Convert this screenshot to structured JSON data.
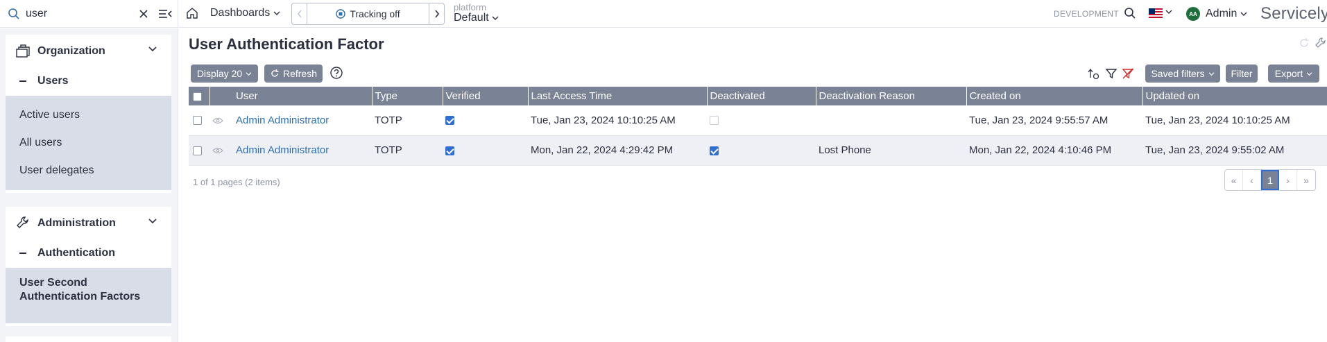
{
  "search": {
    "value": "user"
  },
  "topbar": {
    "dashboards_label": "Dashboards",
    "tracking_label": "Tracking off",
    "platform_label": "platform",
    "platform_value": "Default",
    "environment": "DEVELOPMENT",
    "user_initials": "AA",
    "user_name": "Admin",
    "brand": "Servicely"
  },
  "sidebar": {
    "sections": [
      {
        "title": "Organization",
        "subtitle": "Users",
        "items": [
          "Active users",
          "All users",
          "User delegates"
        ]
      },
      {
        "title": "Administration",
        "subtitle": "Authentication",
        "items": [
          "User Second Authentication Factors"
        ]
      }
    ]
  },
  "page": {
    "title": "User Authentication Factor",
    "display_label": "Display 20",
    "refresh_label": "Refresh",
    "saved_filters_label": "Saved filters",
    "filter_label": "Filter",
    "export_label": "Export"
  },
  "table": {
    "columns": [
      "User",
      "Type",
      "Verified",
      "Last Access Time",
      "Deactivated",
      "Deactivation Reason",
      "Created on",
      "Updated on"
    ],
    "rows": [
      {
        "user": "Admin Administrator",
        "type": "TOTP",
        "verified": true,
        "last_access": "Tue, Jan 23, 2024 10:10:25 AM",
        "deactivated": false,
        "reason": "",
        "created": "Tue, Jan 23, 2024 9:55:57 AM",
        "updated": "Tue, Jan 23, 2024 10:10:25 AM"
      },
      {
        "user": "Admin Administrator",
        "type": "TOTP",
        "verified": true,
        "last_access": "Mon, Jan 22, 2024 4:29:42 PM",
        "deactivated": true,
        "reason": "Lost Phone",
        "created": "Mon, Jan 22, 2024 4:10:46 PM",
        "updated": "Tue, Jan 23, 2024 9:55:02 AM"
      }
    ]
  },
  "pager": {
    "summary": "1 of 1 pages (2 items)",
    "current_page": "1"
  },
  "colors": {
    "accent": "#7a8396",
    "link": "#2f6fb0",
    "check": "#2f6fd1",
    "sidebar_active": "#d9dde8"
  }
}
